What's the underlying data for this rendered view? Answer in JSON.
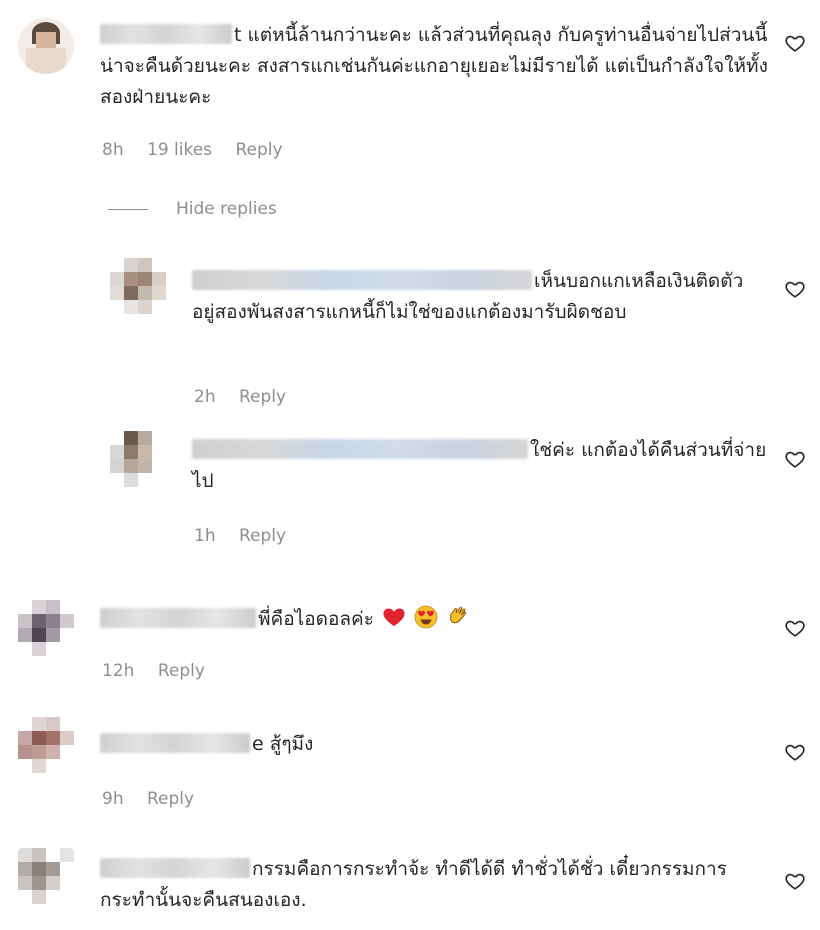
{
  "comments": [
    {
      "text": "t แต่หนี้ล้านกว่านะคะ แล้วส่วนที่คุณลุง กับครูท่านอื่นจ่ายไปส่วนนี้น่าจะคืนด้วยนะคะ สงสารแกเช่นกันค่ะแกอายุเยอะไม่มีรายได้ แต่เป็นกำลังใจให้ทั้งสองฝ่ายนะคะ",
      "time": "8h",
      "likes": "19 likes",
      "reply": "Reply"
    },
    {
      "text": "เห็นบอกแกเหลือเงินติดตัวอยู่สองพันสงสารแกหนี้ก็ไม่ใช่ของแกต้องมารับผิดชอบ",
      "time": "2h",
      "reply": "Reply"
    },
    {
      "text": "ใช่ค่ะ แกต้องได้คืนส่วนที่จ่ายไป",
      "time": "1h",
      "reply": "Reply"
    },
    {
      "text": "พี่คือไอดอลค่ะ",
      "time": "12h",
      "reply": "Reply"
    },
    {
      "text": "e สู้ๆมึง",
      "time": "9h",
      "reply": "Reply"
    },
    {
      "text": "กรรมคือการกระทำจ้ะ ทำดีได้ดี ทำชั่วได้ชั่ว เดี๋ยวกรรมการกระทำนั้นจะคืนสนองเอง.",
      "time": "",
      "reply": ""
    }
  ],
  "hide_replies": "Hide replies",
  "icons": {
    "like": "heart-outline-icon",
    "emoji": [
      "red-heart-emoji",
      "heart-eyes-emoji",
      "clapping-hands-emoji"
    ]
  },
  "colors": {
    "text": "#262626",
    "meta": "#8e8e8e",
    "heart_red": "#e0212e",
    "emoji_yellow": "#f7c02a"
  }
}
